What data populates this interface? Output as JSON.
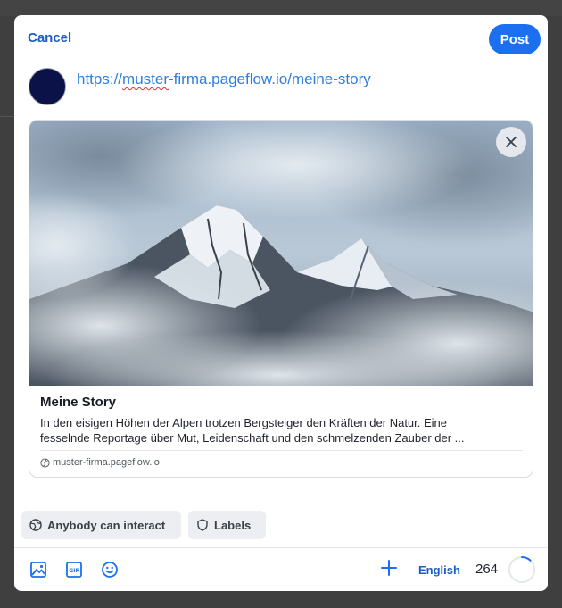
{
  "header": {
    "cancel_label": "Cancel",
    "post_label": "Post"
  },
  "composer": {
    "url_part1": "https://",
    "url_part2": "muster",
    "url_part3": "-firma.pageflow.io/meine-story"
  },
  "preview": {
    "title": "Meine Story",
    "desc_line1": "In den eisigen Höhen der Alpen trotzen Bergsteiger den Kräften der Natur. Eine",
    "desc_line2": "fesselnde Reportage über Mut, Leidenschaft und den schmelzenden Zauber der ...",
    "domain": "muster-firma.pageflow.io"
  },
  "options": {
    "interact_label": "Anybody can interact",
    "labels_label": "Labels"
  },
  "toolbar": {
    "language": "English",
    "char_remaining": "264",
    "char_fraction_used": 0.12
  },
  "colors": {
    "accent": "#1d6ff2",
    "link": "#2f7fe0",
    "avatar": "#0a1248"
  },
  "icons": [
    "image-icon",
    "gif-icon",
    "emoji-icon",
    "plus-icon",
    "globe-icon",
    "shield-icon",
    "close-icon",
    "character-ring-icon"
  ]
}
